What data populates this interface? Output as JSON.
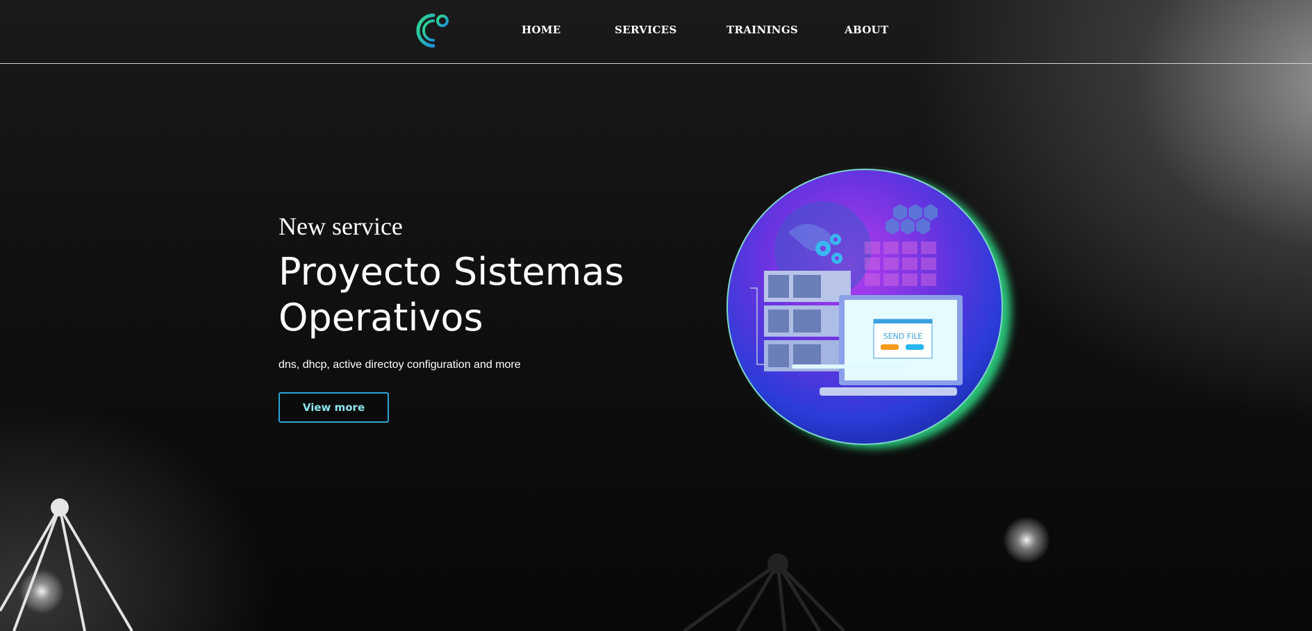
{
  "nav": {
    "logo_name": "brand-logo",
    "items": [
      {
        "label": "HOME"
      },
      {
        "label": "SERVICES"
      },
      {
        "label": "TRAININGS"
      },
      {
        "label": "ABOUT"
      }
    ]
  },
  "hero": {
    "eyebrow": "New service",
    "title_line1": "Proyecto Sistemas",
    "title_line2": "Operativos",
    "subtitle": "dns, dhcp, active directoy configuration and more",
    "button_label": "View more",
    "illustration": {
      "send_file_label": "SEND FILE"
    }
  },
  "colors": {
    "accent_green": "#2ee08a",
    "accent_cyan": "#2aa6d6",
    "button_text": "#8ee6ee",
    "circle_purple": "#8a2be2",
    "circle_blue": "#2a3cd8"
  }
}
